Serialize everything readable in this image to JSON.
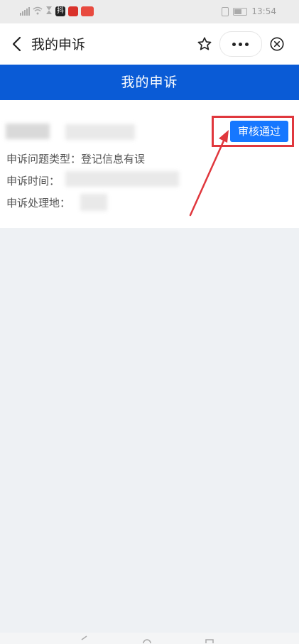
{
  "status_bar": {
    "signal": "⁴ᴳ",
    "app_badge_1": "抖",
    "app_badge_2": "",
    "app_badge_3": "",
    "time": "13:54"
  },
  "nav": {
    "title": "我的申诉",
    "icons": [
      "back-icon",
      "star-icon",
      "more-icon",
      "close-icon"
    ]
  },
  "banner": {
    "title": "我的申诉"
  },
  "appeal": {
    "status_label": "审核通过",
    "type_label": "申诉问题类型：",
    "type_value": "登记信息有误",
    "time_label": "申诉时间：",
    "place_label": "申诉处理地："
  },
  "colors": {
    "accent": "#0a5bd6",
    "status_button": "#1677ff",
    "highlight": "#e0373d",
    "background": "#eef1f4"
  }
}
